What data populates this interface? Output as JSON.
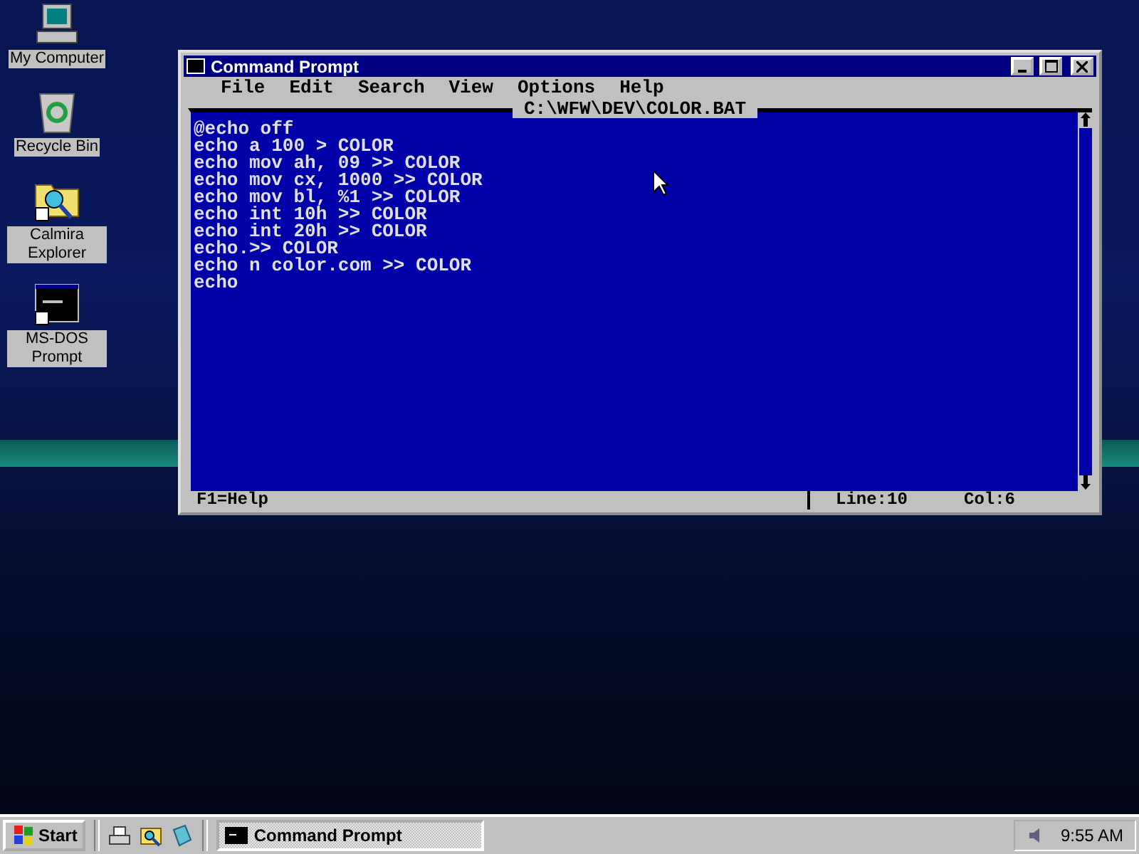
{
  "desktop_icons": [
    {
      "label": "My Computer",
      "kind": "computer"
    },
    {
      "label": "Recycle Bin",
      "kind": "recycle"
    },
    {
      "label": "Calmira Explorer",
      "kind": "explorer"
    },
    {
      "label": "MS-DOS Prompt",
      "kind": "dos"
    }
  ],
  "window": {
    "title": "Command Prompt",
    "menu": [
      "File",
      "Edit",
      "Search",
      "View",
      "Options",
      "Help"
    ],
    "file_title": "C:\\WFW\\DEV\\COLOR.BAT",
    "lines": [
      "@echo off",
      "echo a 100 > COLOR",
      "echo mov ah, 09 >> COLOR",
      "echo mov cx, 1000 >> COLOR",
      "echo mov bl, %1 >> COLOR",
      "echo int 10h >> COLOR",
      "echo int 20h >> COLOR",
      "echo.>> COLOR",
      "echo n color.com >> COLOR",
      "echo"
    ],
    "status_bar": {
      "help": "F1=Help",
      "line": "Line:10",
      "col": "Col:6"
    }
  },
  "taskbar": {
    "start": "Start",
    "quick_launch": [
      {
        "kind": "printer"
      },
      {
        "kind": "explorer"
      },
      {
        "kind": "notebook"
      }
    ],
    "tasks": [
      {
        "label": "Command Prompt",
        "selected": true
      }
    ],
    "clock": "9:55 AM"
  }
}
